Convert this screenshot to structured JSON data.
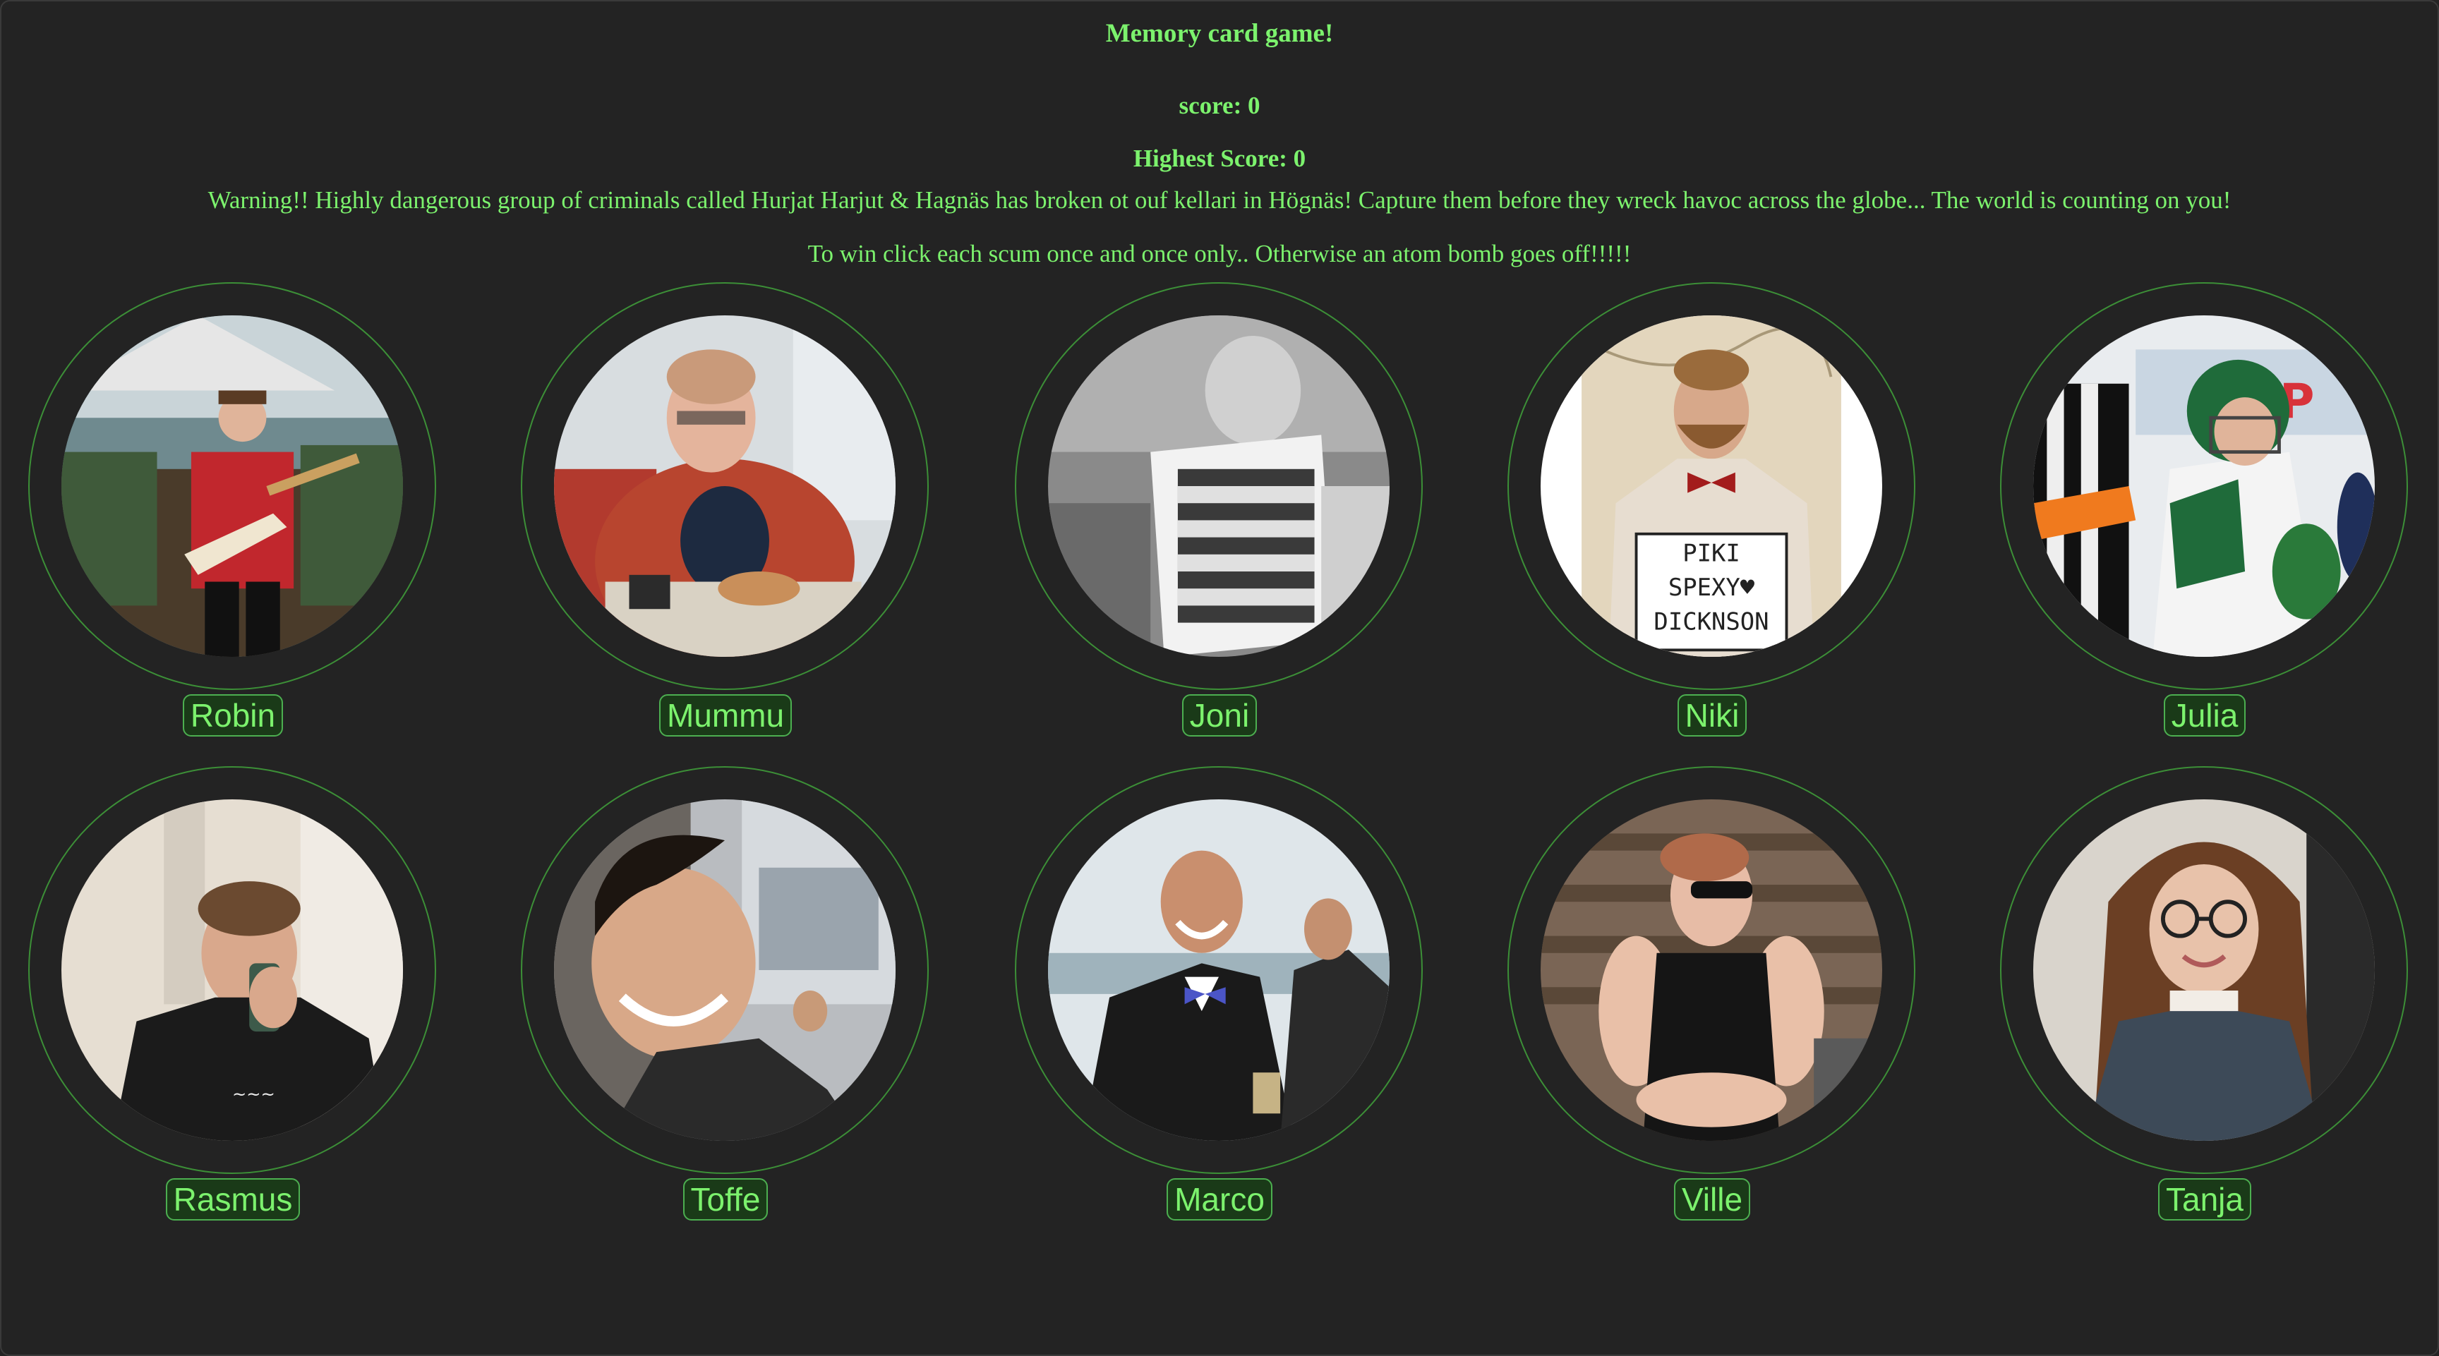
{
  "header": {
    "title": "Memory card game!",
    "score": "score: 0",
    "highest_score": "Highest Score: 0",
    "warning": "Warning!! Highly dangerous group of criminals called Hurjat Harjut & Hagnäs has broken ot ouf kellari in Högnäs! Capture them before they wreck havoc across the globe... The world is counting on you!",
    "rule": "To win click each scum once and once only.. Otherwise an atom bomb goes off!!!!!"
  },
  "cards": [
    {
      "name": "Robin"
    },
    {
      "name": "Mummu"
    },
    {
      "name": "Joni"
    },
    {
      "name": "Niki"
    },
    {
      "name": "Julia"
    },
    {
      "name": "Rasmus"
    },
    {
      "name": "Toffe"
    },
    {
      "name": "Marco"
    },
    {
      "name": "Ville"
    },
    {
      "name": "Tanja"
    }
  ],
  "photo_signs": {
    "niki": [
      "PIKI",
      "SPEXY♥",
      "DICKNSON"
    ]
  },
  "colors": {
    "background": "#232323",
    "text": "#7cf26d",
    "ring": "#3c8f37",
    "label_bg": "#1a3a18",
    "label_border": "#4caf50"
  }
}
